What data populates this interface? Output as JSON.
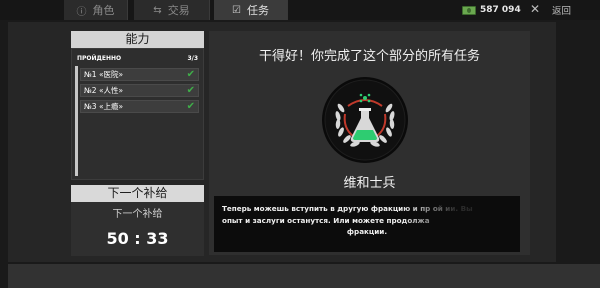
{
  "tabs": [
    {
      "label": "角色",
      "icon": "character-icon",
      "active": false
    },
    {
      "label": "交易",
      "icon": "trade-icon",
      "active": false
    },
    {
      "label": "任务",
      "icon": "tasks-icon",
      "active": true
    }
  ],
  "header": {
    "money": "587 094",
    "money_icon": "cash-icon",
    "close_symbol": "✕",
    "back_label": "返回"
  },
  "abilities": {
    "title": "能力",
    "passed_label": "ПРОЙДЕННО",
    "passed_count": "3/3",
    "items": [
      {
        "label": "№1 «医院»",
        "done": true
      },
      {
        "label": "№2 «人性»",
        "done": true
      },
      {
        "label": "№3 «上瘾»",
        "done": true
      }
    ]
  },
  "supply": {
    "title": "下一个补给",
    "subtitle": "下一个补给",
    "timer": "50 : 33"
  },
  "completion": {
    "title": "干得好！你完成了这个部分的所有任务",
    "badge_icon": "flask-laurel-badge-icon",
    "rank": "维和士兵",
    "info_lines": [
      "Теперь можешь вступить в другую фракцию и пр      ой    ии. Вы",
      "опыт и заслуги останутся. Или можете продолжа",
      "фракции."
    ]
  },
  "colors": {
    "accent_green": "#3fae49",
    "money_green": "#6aa84f",
    "badge_red": "#c0392b",
    "badge_green": "#2ecc71"
  }
}
